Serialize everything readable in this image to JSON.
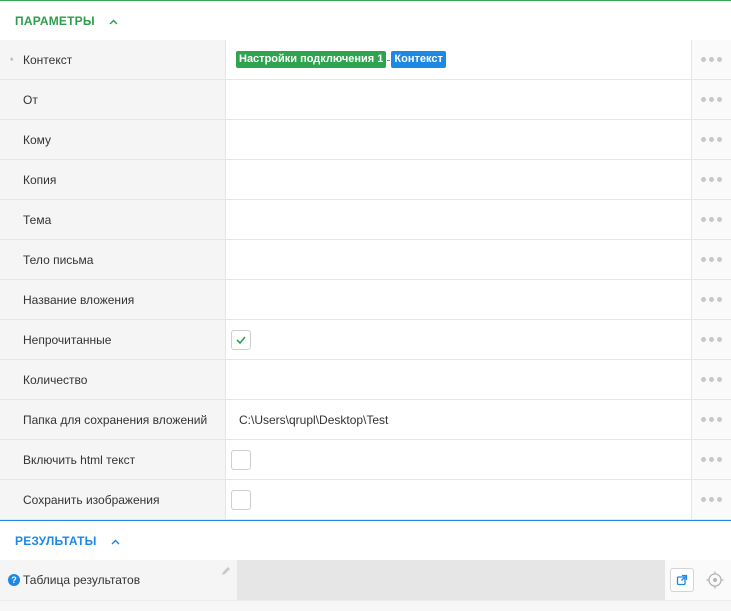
{
  "params_section": {
    "title": "ПАРАМЕТРЫ"
  },
  "rows": [
    {
      "label": "Контекст",
      "required_mark": "*",
      "chips": [
        "Настройки подключения 1",
        "Контекст"
      ]
    },
    {
      "label": "От"
    },
    {
      "label": "Кому"
    },
    {
      "label": "Копия"
    },
    {
      "label": "Тема"
    },
    {
      "label": "Тело письма"
    },
    {
      "label": "Название вложения"
    },
    {
      "label": "Непрочитанные",
      "checkbox": true
    },
    {
      "label": "Количество"
    },
    {
      "label": "Папка для сохранения вложений",
      "value": "C:\\Users\\qrupl\\Desktop\\Test"
    },
    {
      "label": "Включить html текст",
      "checkbox": false
    },
    {
      "label": "Сохранить изображения",
      "checkbox": false
    }
  ],
  "results_section": {
    "title": "РЕЗУЛЬТАТЫ"
  },
  "results_row": {
    "label": "Таблица результатов",
    "help": "?"
  },
  "colors": {
    "params_accent": "#2e9d4d",
    "results_accent": "#1e88e5",
    "chip_green": "#2ea44f",
    "chip_blue": "#1e88e5"
  },
  "icons": [
    "chevron-up-icon",
    "more-dots-icon",
    "check-icon",
    "help-icon",
    "pencil-icon",
    "open-external-icon",
    "target-icon"
  ]
}
